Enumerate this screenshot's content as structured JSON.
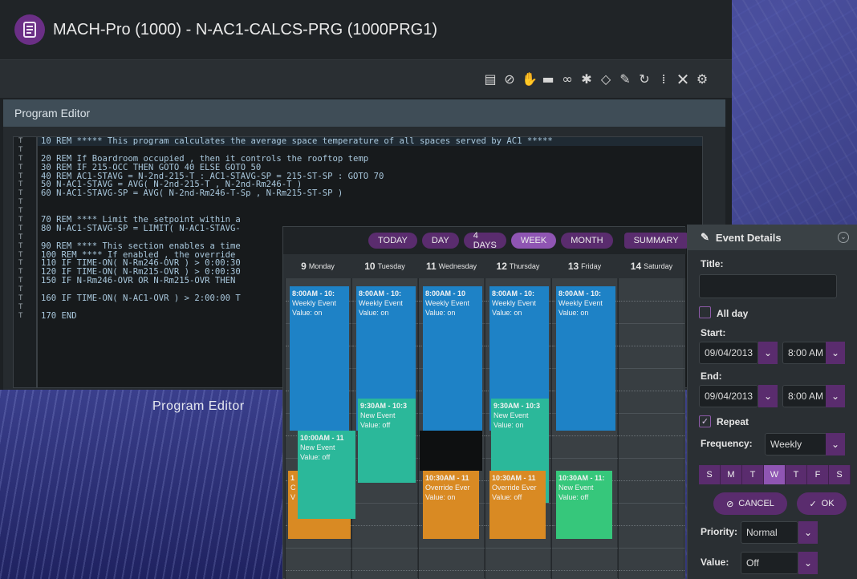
{
  "window": {
    "title": "MACH-Pro (1000) - N-AC1-CALCS-PRG (1000PRG1)"
  },
  "toolbar": {
    "icons": [
      "compile-icon",
      "disable-icon",
      "hand-icon",
      "folder-icon",
      "binoculars-icon",
      "bug-icon",
      "code-icon",
      "edit-icon",
      "refresh-icon",
      "numbers-icon",
      "close-icon",
      "gear-icon"
    ]
  },
  "editor": {
    "header": "Program Editor",
    "lines": [
      {
        "g": "T",
        "text": "10 REM ***** This program calculates the average space temperature of all spaces served by AC1 *****"
      },
      {
        "g": "T",
        "text": ""
      },
      {
        "g": "T",
        "text": "20 REM If Boardroom occupied , then it controls the rooftop temp"
      },
      {
        "g": "T",
        "text": "30 REM IF 215-OCC THEN GOTO 40 ELSE GOTO 50"
      },
      {
        "g": "T",
        "text": "40 REM AC1-STAVG = N-2nd-215-T : AC1-STAVG-SP = 215-ST-SP : GOTO 70"
      },
      {
        "g": "T",
        "text": "50 N-AC1-STAVG = AVG( N-2nd-215-T , N-2nd-Rm246-T )"
      },
      {
        "g": "T",
        "text": "60 N-AC1-STAVG-SP = AVG( N-2nd-Rm246-T-Sp , N-Rm215-ST-SP )"
      },
      {
        "g": "T",
        "text": ""
      },
      {
        "g": "T",
        "text": ""
      },
      {
        "g": "T",
        "text": "70 REM **** Limit the setpoint within a"
      },
      {
        "g": "T",
        "text": "80 N-AC1-STAVG-SP = LIMIT( N-AC1-STAVG-"
      },
      {
        "g": "T",
        "text": ""
      },
      {
        "g": "T",
        "text": "90 REM **** This section enables a time"
      },
      {
        "g": "T",
        "text": "100 REM **** If enabled , the override"
      },
      {
        "g": "T",
        "text": "110 IF TIME-ON( N-Rm246-OVR ) > 0:00:30"
      },
      {
        "g": "T",
        "text": "120 IF TIME-ON( N-Rm215-OVR ) > 0:00:30"
      },
      {
        "g": "T",
        "text": "150 IF N-Rm246-OVR OR N-Rm215-OVR THEN"
      },
      {
        "g": "T",
        "text": ""
      },
      {
        "g": "T",
        "text": "160 IF TIME-ON( N-AC1-OVR ) > 2:00:00 T"
      },
      {
        "g": "T",
        "text": ""
      },
      {
        "g": "T",
        "text": "170 END"
      }
    ]
  },
  "caption": "Program Editor",
  "calendar": {
    "views": [
      "TODAY",
      "DAY",
      "4 DAYS",
      "WEEK",
      "MONTH"
    ],
    "active_view": "WEEK",
    "summary": "SUMMARY",
    "days": [
      {
        "num": "9",
        "name": "Monday"
      },
      {
        "num": "10",
        "name": "Tuesday"
      },
      {
        "num": "11",
        "name": "Wednesday"
      },
      {
        "num": "12",
        "name": "Thursday"
      },
      {
        "num": "13",
        "name": "Friday"
      },
      {
        "num": "14",
        "name": "Saturday"
      }
    ],
    "events": [
      {
        "day": 0,
        "start": 0,
        "end": 3.6,
        "color": "blue",
        "time": "8:00AM - 10:",
        "title": "Weekly Event",
        "value": "Value: on"
      },
      {
        "day": 1,
        "start": 0,
        "end": 3.6,
        "color": "blue",
        "time": "8:00AM - 10:",
        "title": "Weekly Event",
        "value": "Value: on"
      },
      {
        "day": 2,
        "start": 0,
        "end": 3.6,
        "color": "blue",
        "time": "8:00AM - 10",
        "title": "Weekly Event",
        "value": "Value: on"
      },
      {
        "day": 3,
        "start": 0,
        "end": 3.6,
        "color": "blue",
        "time": "8:00AM - 10:",
        "title": "Weekly Event",
        "value": "Value: on"
      },
      {
        "day": 4,
        "start": 0,
        "end": 3.6,
        "color": "blue",
        "time": "8:00AM - 10:",
        "title": "Weekly Event",
        "value": "Value: on"
      },
      {
        "day": 1,
        "start": 2.8,
        "end": 4.9,
        "color": "green",
        "time": "9:30AM - 10:3",
        "title": "New Event",
        "value": "Value: off"
      },
      {
        "day": 3,
        "start": 2.8,
        "end": 5.4,
        "color": "green",
        "time": "9:30AM - 10:3",
        "title": "New Event",
        "value": "Value: on"
      },
      {
        "day": 2,
        "start": 3.6,
        "end": 4.6,
        "color": "black",
        "time": "",
        "title": "",
        "value": ""
      },
      {
        "day": 0,
        "start": 4.6,
        "end": 6.3,
        "color": "orange",
        "time": "1",
        "title": "C",
        "value": "V"
      },
      {
        "day": 0,
        "start": 3.6,
        "end": 5.8,
        "color": "green",
        "time": "10:00AM - 11",
        "title": "New Event",
        "value": "Value: off"
      },
      {
        "day": 2,
        "start": 4.6,
        "end": 6.3,
        "color": "orange",
        "time": "10:30AM - 11",
        "title": "Override Ever",
        "value": "Value: on"
      },
      {
        "day": 3,
        "start": 4.6,
        "end": 6.3,
        "color": "orange",
        "time": "10:30AM - 11",
        "title": "Override Ever",
        "value": "Value: off"
      },
      {
        "day": 4,
        "start": 4.6,
        "end": 6.3,
        "color": "lgreen",
        "time": "10:30AM - 11:",
        "title": "New Event",
        "value": "Value: off"
      }
    ]
  },
  "event_details": {
    "header": "Event Details",
    "title_label": "Title:",
    "title_value": "",
    "all_day_label": "All day",
    "all_day_checked": false,
    "start_label": "Start:",
    "start_date": "09/04/2013",
    "start_time": "8:00 AM",
    "end_label": "End:",
    "end_date": "09/04/2013",
    "end_time": "8:00 AM",
    "repeat_label": "Repeat",
    "repeat_checked": true,
    "frequency_label": "Frequency:",
    "frequency_value": "Weekly",
    "weekdays": [
      "S",
      "M",
      "T",
      "W",
      "T",
      "F",
      "S"
    ],
    "selected_weekday": 3,
    "cancel_label": "CANCEL",
    "ok_label": "OK",
    "priority_label": "Priority:",
    "priority_value": "Normal",
    "value_label": "Value:",
    "value_value": "Off"
  },
  "colors": {
    "accent": "#5a2c6e",
    "accent_active": "#8f55b3",
    "event_blue": "#1e82c6",
    "event_green": "#2bb89a",
    "event_lgreen": "#36c77b",
    "event_orange": "#d98a23"
  }
}
